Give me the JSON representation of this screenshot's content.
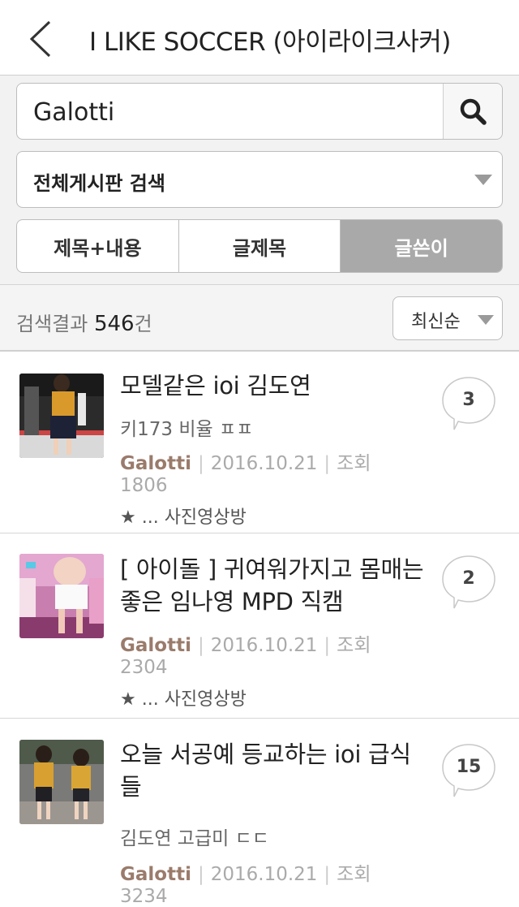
{
  "header": {
    "title": "I LIKE SOCCER (아이라이크사커)"
  },
  "search": {
    "query": "Galotti"
  },
  "scope": {
    "label": "전체게시판 검색"
  },
  "segments": [
    {
      "label": "제목+내용",
      "active": false
    },
    {
      "label": "글제목",
      "active": false
    },
    {
      "label": "글쓴이",
      "active": true
    }
  ],
  "results": {
    "prefix": "검색결과 ",
    "count": "546",
    "suffix": "건"
  },
  "sort": {
    "label": "최신순"
  },
  "posts": [
    {
      "title": "모델같은 ioi 김도연",
      "subtitle": "키173 비율 ㅍㅍ",
      "author": "Galotti",
      "date": "2016.10.21",
      "views_label": "조회",
      "views": "1806",
      "board": "★ ... 사진영상방",
      "comments": "3"
    },
    {
      "title": "[ 아이돌 ] 귀여워가지고 몸매는 좋은 임나영 MPD 직캠",
      "author": "Galotti",
      "date": "2016.10.21",
      "views_label": "조회",
      "views": "2304",
      "board": "★ ... 사진영상방",
      "comments": "2"
    },
    {
      "title": "오늘 서공예 등교하는 ioi 급식들",
      "subtitle": "김도연 고급미 ㄷㄷ",
      "author": "Galotti",
      "date": "2016.10.21",
      "views_label": "조회",
      "views": "3234",
      "comments": "15"
    }
  ]
}
